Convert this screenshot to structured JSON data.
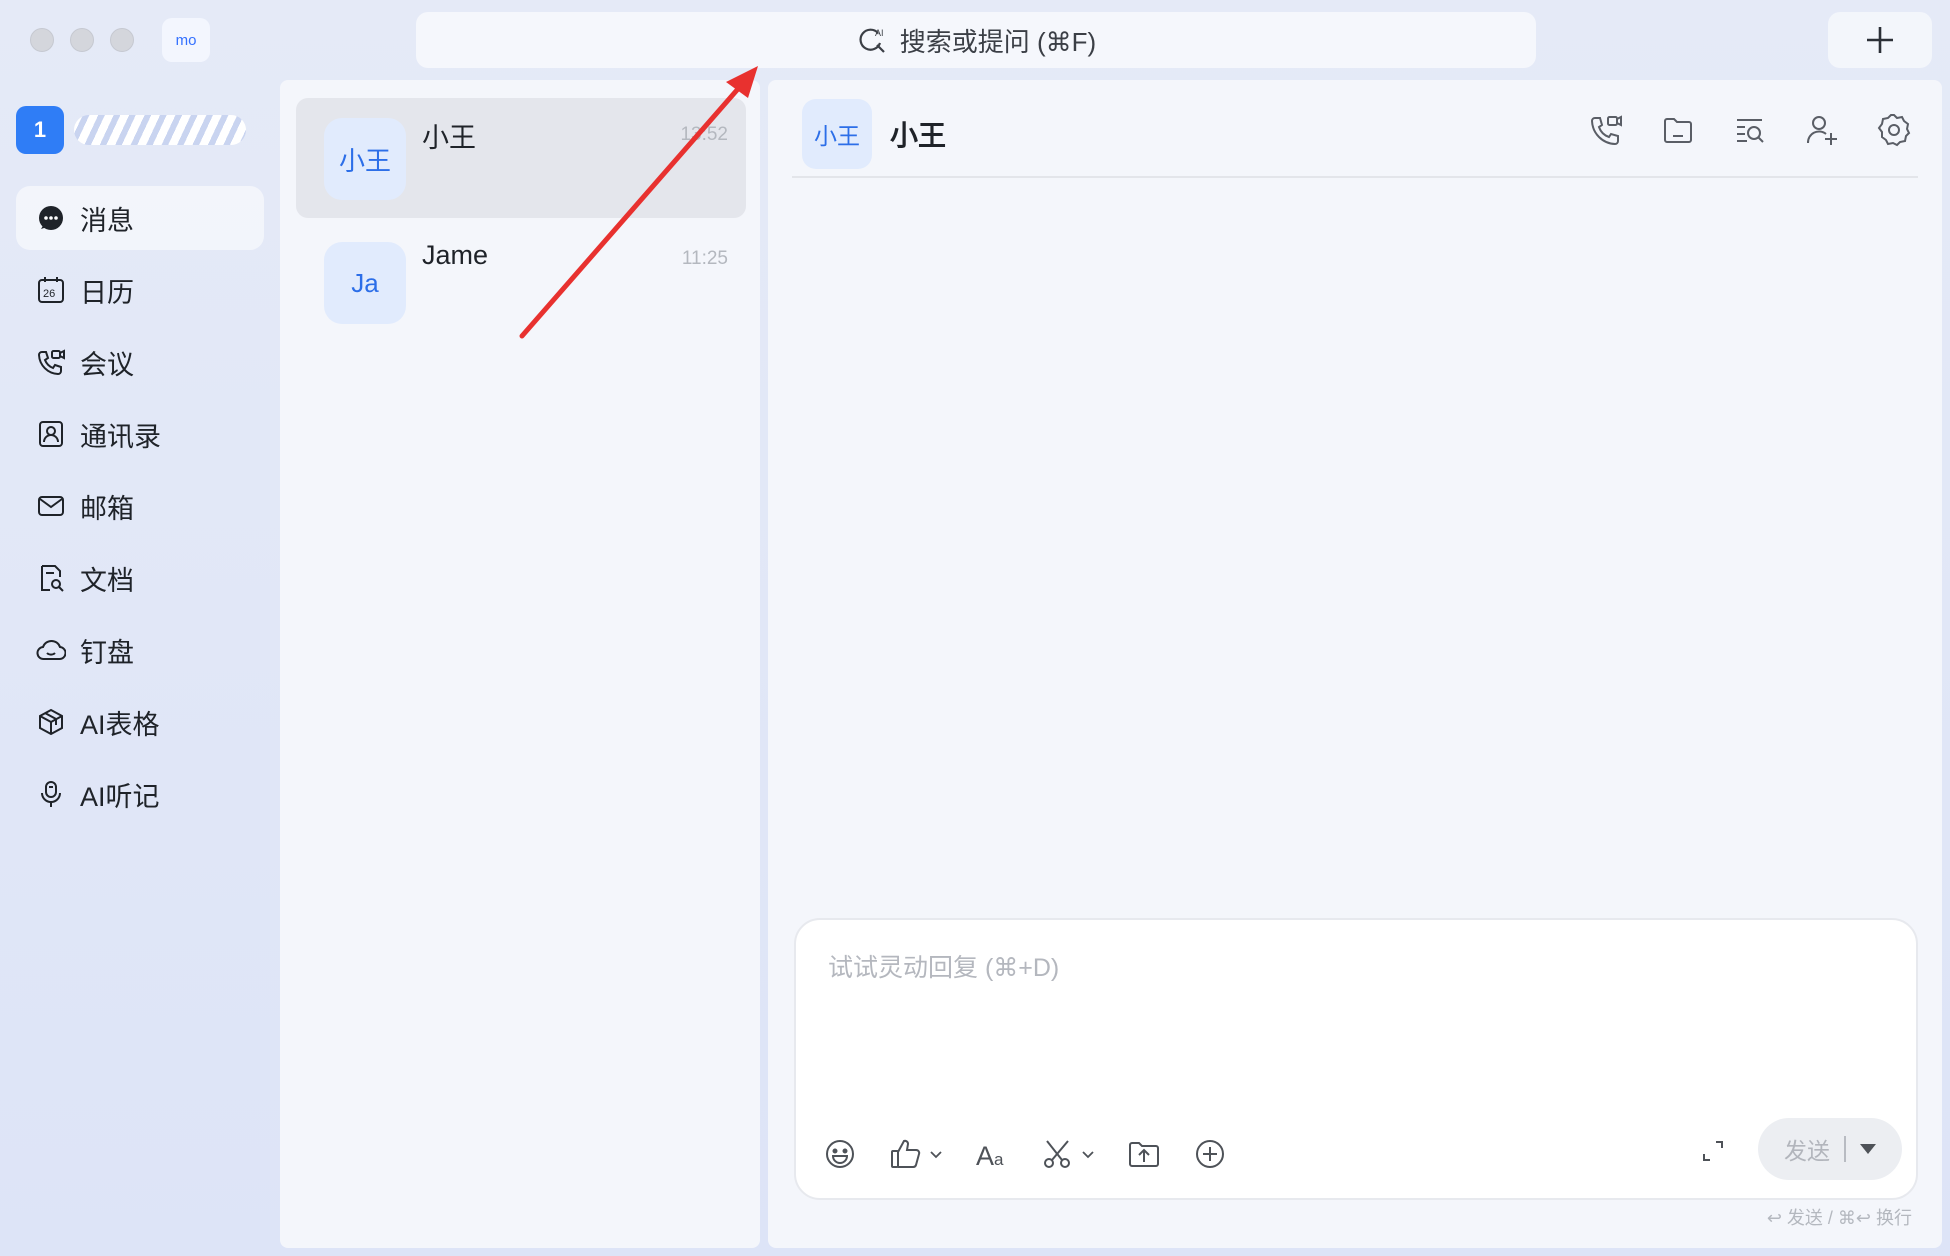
{
  "window": {
    "workspace_badge": "mo",
    "search_placeholder": "搜索或提问 (⌘F)"
  },
  "profile": {
    "badge_number": "1"
  },
  "nav": [
    {
      "label": "消息",
      "icon": "message-icon",
      "active": true
    },
    {
      "label": "日历",
      "icon": "calendar-icon"
    },
    {
      "label": "会议",
      "icon": "meeting-icon"
    },
    {
      "label": "通讯录",
      "icon": "contacts-icon"
    },
    {
      "label": "邮箱",
      "icon": "mail-icon"
    },
    {
      "label": "文档",
      "icon": "docs-icon"
    },
    {
      "label": "钉盘",
      "icon": "cloud-drive-icon"
    },
    {
      "label": "AI表格",
      "icon": "ai-table-icon"
    },
    {
      "label": "AI听记",
      "icon": "ai-transcribe-icon"
    }
  ],
  "chats": [
    {
      "avatar_text": "小王",
      "name": "小王",
      "time": "13:52",
      "active": true
    },
    {
      "avatar_text": "Ja",
      "name": "Jame",
      "time": "11:25"
    }
  ],
  "conversation": {
    "avatar_text": "小王",
    "title": "小王",
    "header_tools": [
      "call-icon",
      "folder-icon",
      "search-history-icon",
      "add-member-icon",
      "settings-icon"
    ],
    "composer_placeholder": "试试灵动回复 (⌘+D)",
    "composer_tools": [
      "emoji-icon",
      "thumbs-up-icon",
      "font-style-icon",
      "scissors-icon",
      "upload-folder-icon",
      "add-circle-icon"
    ],
    "send_label": "发送",
    "send_hint": "↩ 发送 / ⌘↩ 换行"
  },
  "colors": {
    "accent": "#3370ff",
    "annotation_arrow": "#e8312f"
  }
}
